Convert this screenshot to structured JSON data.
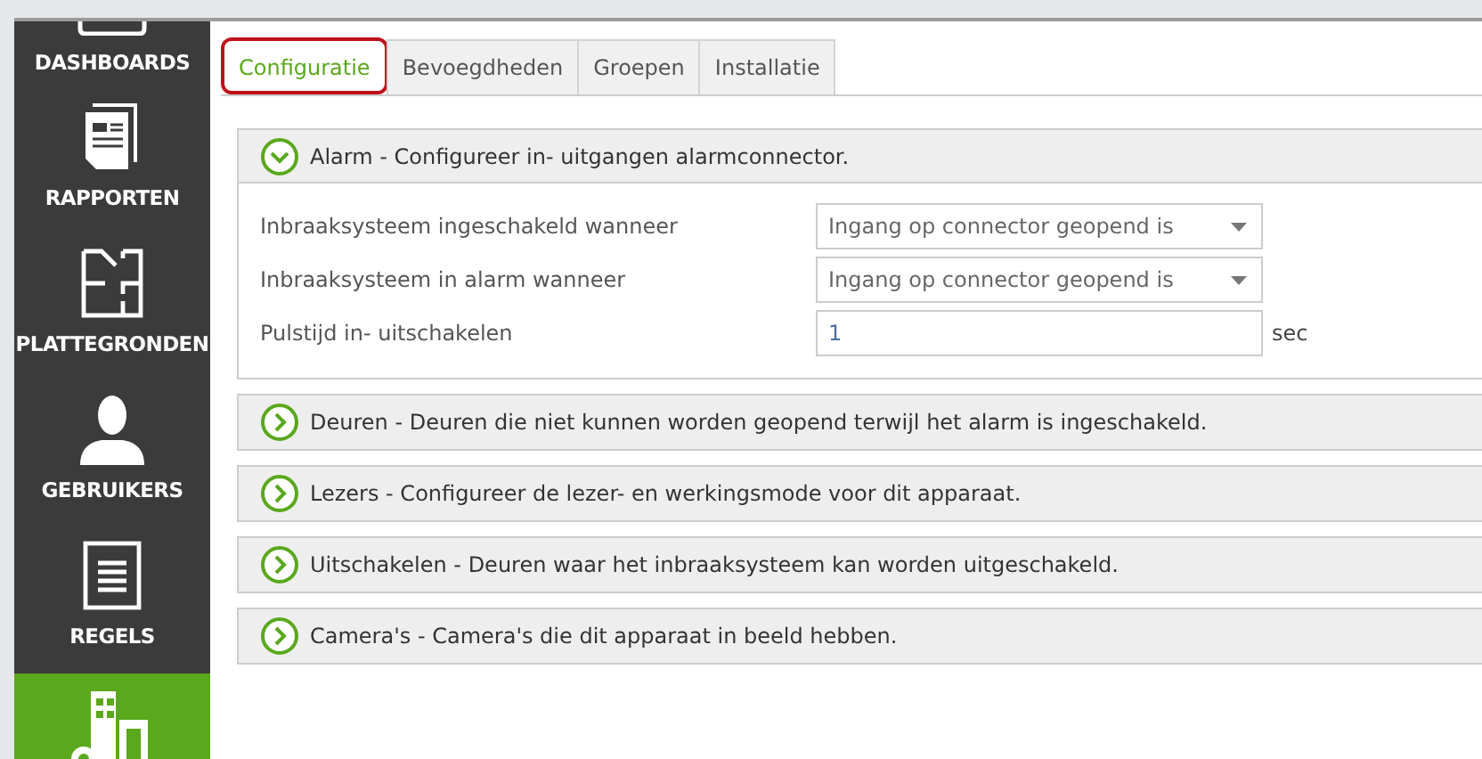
{
  "sidebar": {
    "items": [
      {
        "label": "DASHBOARDS",
        "selected": false
      },
      {
        "label": "RAPPORTEN",
        "selected": false
      },
      {
        "label": "PLATTEGRONDEN",
        "selected": false
      },
      {
        "label": "GEBRUIKERS",
        "selected": false
      },
      {
        "label": "REGELS",
        "selected": false
      },
      {
        "selected": true
      }
    ]
  },
  "tabs": [
    {
      "label": "Configuratie",
      "selected": true,
      "highlighted": true
    },
    {
      "label": "Bevoegdheden",
      "selected": false,
      "highlighted": false
    },
    {
      "label": "Groepen",
      "selected": false,
      "highlighted": false
    },
    {
      "label": "Installatie",
      "selected": false,
      "highlighted": false
    }
  ],
  "panels": [
    {
      "title": "Alarm - Configureer in- uitgangen alarmconnector.",
      "expanded": true,
      "fields": [
        {
          "label": "Inbraaksysteem ingeschakeld wanneer",
          "kind": "select",
          "value": "Ingang op connector geopend is"
        },
        {
          "label": "Inbraaksysteem in alarm wanneer",
          "kind": "select",
          "value": "Ingang op connector geopend is"
        },
        {
          "label": "Pulstijd in- uitschakelen",
          "kind": "text",
          "value": "1",
          "unit": "sec"
        }
      ]
    },
    {
      "title": "Deuren - Deuren die niet kunnen worden geopend terwijl het alarm is ingeschakeld.",
      "expanded": false
    },
    {
      "title": "Lezers - Configureer de lezer- en werkingsmode voor dit apparaat.",
      "expanded": false
    },
    {
      "title": "Uitschakelen - Deuren waar het inbraaksysteem kan worden uitgeschakeld.",
      "expanded": false
    },
    {
      "title": "Camera's - Camera's die dit apparaat in beeld hebben.",
      "expanded": false
    }
  ]
}
